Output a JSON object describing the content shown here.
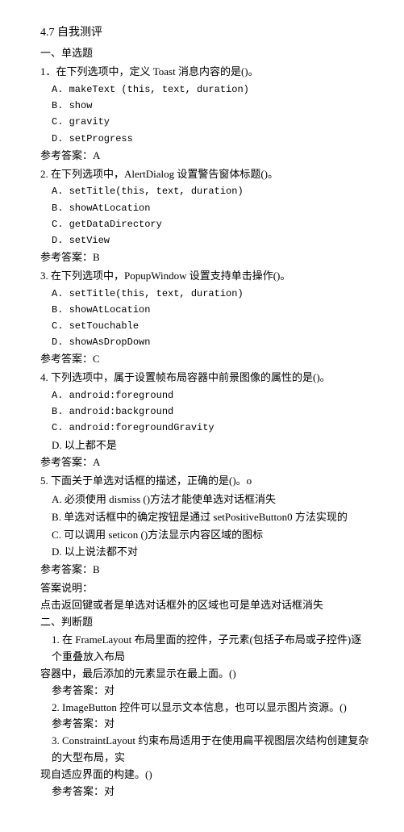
{
  "title": "4.7 自我测评",
  "section1": "一、单选题",
  "q1": {
    "text": "1．在下列选项中，定义 Toast 消息内容的是()。",
    "a": "A. makeText (this, text, duration)",
    "b": "B. show",
    "c": "C. gravity",
    "d": "D. setProgress",
    "ans": "参考答案：A"
  },
  "q2": {
    "text": "2. 在下列选项中，AlertDialog 设置警告窗体标题()。",
    "a": "A. setTitle(this, text, duration)",
    "b": "B. showAtLocation",
    "c": "C. getDataDirectory",
    "d": "D. setView",
    "ans": "参考答案：B"
  },
  "q3": {
    "text": "3. 在下列选项中，PopupWindow 设置支持单击操作()。",
    "a": "A. setTitle(this, text, duration)",
    "b": "B. showAtLocation",
    "c": "C. setTouchable",
    "d": "D. showAsDropDown",
    "ans": "参考答案：C"
  },
  "q4": {
    "text": "4. 下列选项中，属于设置帧布局容器中前景图像的属性的是()。",
    "a": "A. android:foreground",
    "b": "B. android:background",
    "c": "C. android:foregroundGravity",
    "d": "D. 以上都不是",
    "ans": "参考答案：A"
  },
  "q5": {
    "text": "5. 下面关于单选对话框的描述，正确的是()。o",
    "a": "A. 必须使用 dismiss ()方法才能使单选对话框消失",
    "b": "B. 单选对话框中的确定按钮是通过 setPositiveButton0 方法实现的",
    "c": "C. 可以调用 seticon ()方法显示内容区域的图标",
    "d": "D. 以上说法都不对",
    "ans": "参考答案：B"
  },
  "explain_label": "答案说明：",
  "explain_text": "点击返回键或者是单选对话框外的区域也可是单选对话框消失",
  "section2": "二、判断题",
  "j1": {
    "text_a": "1. 在 FrameLayout 布局里面的控件，子元素(包括子布局或子控件)逐个重叠放入布局",
    "text_b": "容器中，最后添加的元素显示在最上面。()",
    "ans": "参考答案：对"
  },
  "j2": {
    "text": "2. ImageButton 控件可以显示文本信息，也可以显示图片资源。()",
    "ans": "参考答案：对"
  },
  "j3": {
    "text_a": "3. ConstraintLayout 约束布局适用于在使用扁平视图层次结构创建复杂的大型布局，实",
    "text_b": "现自适应界面的构建。()",
    "ans": "参考答案：对"
  }
}
